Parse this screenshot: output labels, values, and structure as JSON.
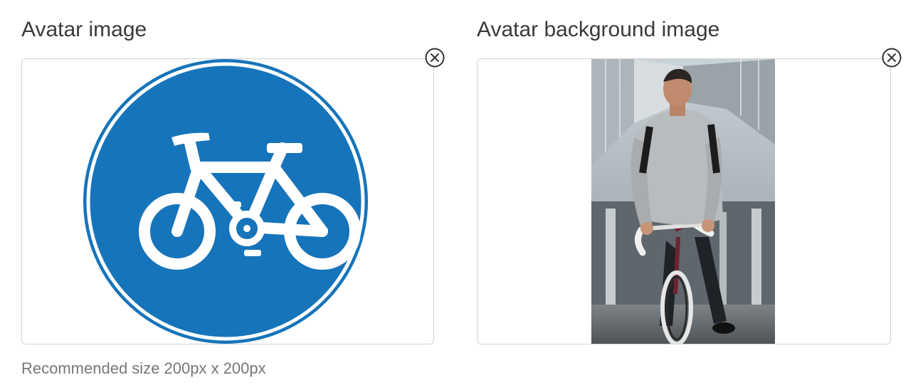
{
  "avatar_field": {
    "label": "Avatar image",
    "hint": "Recommended size 200px x 200px",
    "image": {
      "kind": "bicycle-road-sign",
      "color": "#1674BA"
    }
  },
  "background_field": {
    "label": "Avatar background image",
    "image": {
      "kind": "man-riding-bicycle-photo"
    }
  },
  "colors": {
    "sign_blue": "#1674BA",
    "border": "#CFD3D8",
    "label_text": "#3A3A3A",
    "hint_text": "#777777"
  },
  "icons": {
    "clear": "close-circle-icon"
  }
}
